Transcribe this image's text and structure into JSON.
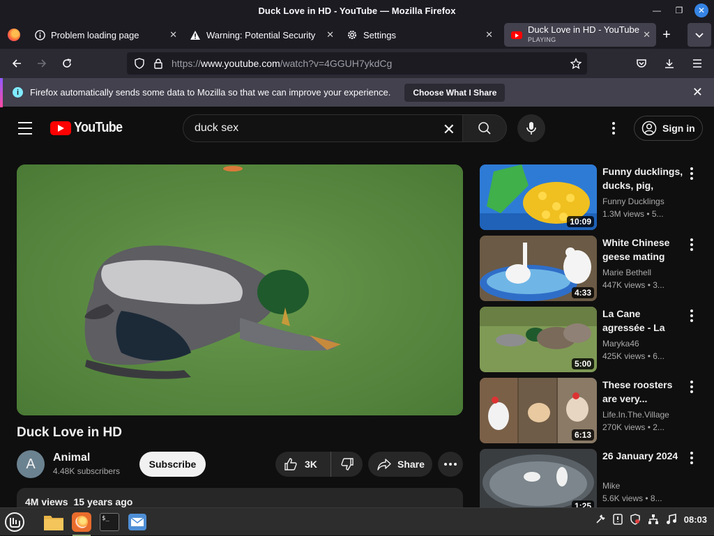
{
  "window": {
    "title": "Duck Love in HD - YouTube — Mozilla Firefox"
  },
  "tabs": [
    {
      "label": "Problem loading page",
      "icon": "info-icon"
    },
    {
      "label": "Warning: Potential Security",
      "icon": "warning-icon"
    },
    {
      "label": "Settings",
      "icon": "gear-icon"
    },
    {
      "label": "Duck Love in HD - YouTube",
      "sublabel": "PLAYING",
      "icon": "youtube-favicon",
      "active": true
    }
  ],
  "urlbar": {
    "scheme": "https://",
    "host": "www.youtube.com",
    "path": "/watch?v=4GGUH7ykdCg"
  },
  "notification": {
    "text": "Firefox automatically sends some data to Mozilla so that we can improve your experience.",
    "button": "Choose What I Share"
  },
  "youtube": {
    "logo_text": "YouTube",
    "search_value": "duck sex",
    "signin": "Sign in"
  },
  "video": {
    "title": "Duck Love in HD",
    "channel": "Animal",
    "channel_initial": "A",
    "subscribers": "4.48K subscribers",
    "subscribe": "Subscribe",
    "likes": "3K",
    "share": "Share",
    "views": "4M views",
    "age": "15 years ago"
  },
  "recommendations": [
    {
      "title": "Funny ducklings, ducks, pig, kitte...",
      "channel": "Funny Ducklings",
      "meta": "1.3M views • 5...",
      "duration": "10:09"
    },
    {
      "title": "White Chinese geese mating",
      "channel": "Marie Bethell",
      "meta": "447K views • 3...",
      "duration": "4:33"
    },
    {
      "title": "La Cane agressée - La Roche de...",
      "channel": "Maryka46",
      "meta": "425K views • 6...",
      "duration": "5:00"
    },
    {
      "title": "These roosters are very...",
      "channel": "Life.In.The.Village",
      "meta": "270K views • 2...",
      "duration": "6:13"
    },
    {
      "title": "26 January 2024",
      "channel": "Mike",
      "meta": "5.6K views • 8...",
      "duration": "1:25"
    }
  ],
  "taskbar": {
    "clock": "08:03",
    "apps": [
      "mint-menu-icon",
      "files-icon",
      "firefox-icon",
      "terminal-icon",
      "mail-icon"
    ]
  }
}
